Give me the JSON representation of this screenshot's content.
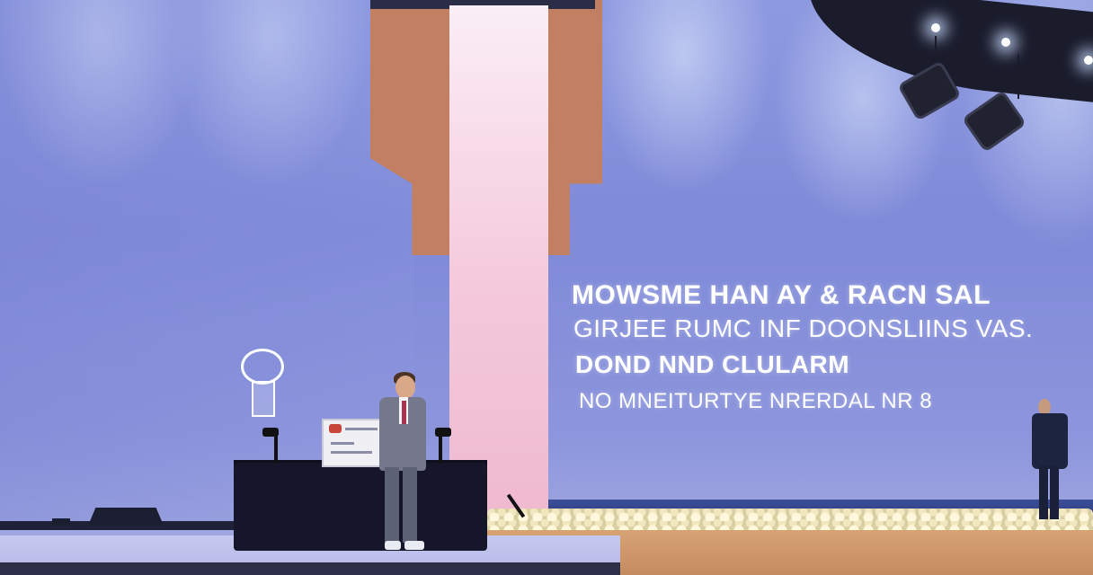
{
  "scene": {
    "type": "photo",
    "subject": "stage presentation",
    "projected_text": [
      "MOWSME HAN AY & RACN SAL",
      "GIRJEE RUMC INF DOONSLIINS VAS.",
      "DOND NND CLULARM",
      "NO MNEITURTYE NRERDAL NR 8"
    ],
    "colors": {
      "wall": "#8e9ae0",
      "banner_orange": "#c27f62",
      "banner_pink": "#f4c9db",
      "podium": "#15162a",
      "floor_wood": "#d7a374"
    }
  }
}
